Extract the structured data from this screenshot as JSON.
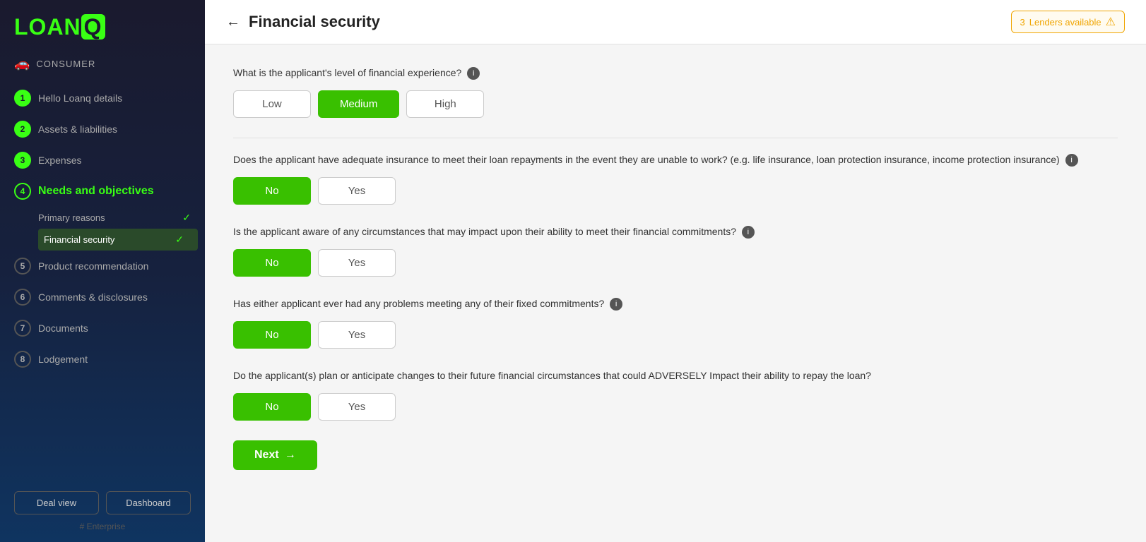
{
  "app": {
    "logo_text": "LOANQ",
    "logo_q": "Q"
  },
  "sidebar": {
    "consumer_label": "CONSUMER",
    "nav_items": [
      {
        "id": 1,
        "label": "Hello Loanq details",
        "state": "done"
      },
      {
        "id": 2,
        "label": "Assets & liabilities",
        "state": "done"
      },
      {
        "id": 3,
        "label": "Expenses",
        "state": "done"
      },
      {
        "id": 4,
        "label": "Needs and objectives",
        "state": "active"
      },
      {
        "id": 5,
        "label": "Product recommendation",
        "state": "default"
      },
      {
        "id": 6,
        "label": "Comments & disclosures",
        "state": "default"
      },
      {
        "id": 7,
        "label": "Documents",
        "state": "default"
      },
      {
        "id": 8,
        "label": "Lodgement",
        "state": "default"
      }
    ],
    "sub_nav": {
      "primary_reasons_label": "Primary reasons",
      "financial_security_label": "Financial security"
    },
    "deal_view_btn": "Deal view",
    "dashboard_btn": "Dashboard",
    "enterprise_label": "# Enterprise"
  },
  "header": {
    "back_label": "←",
    "page_title": "Financial security",
    "lenders_badge": "3  Lenders available",
    "lenders_count": "3"
  },
  "form": {
    "q1": {
      "text": "What is the applicant's level of financial experience?",
      "options": [
        "Low",
        "Medium",
        "High"
      ],
      "selected": "Medium"
    },
    "q2": {
      "text": "Does the applicant have adequate insurance to meet their loan repayments in the event they are unable to work? (e.g. life insurance, loan protection insurance, income protection insurance)",
      "options": [
        "No",
        "Yes"
      ],
      "selected": "No"
    },
    "q3": {
      "text": "Is the applicant aware of any circumstances that may impact upon their ability to meet their financial commitments?",
      "options": [
        "No",
        "Yes"
      ],
      "selected": "No"
    },
    "q4": {
      "text": "Has either applicant ever had any problems meeting any of their fixed commitments?",
      "options": [
        "No",
        "Yes"
      ],
      "selected": "No"
    },
    "q5": {
      "text": "Do the applicant(s) plan or anticipate changes to their future financial circumstances that could ADVERSELY Impact their ability to repay the loan?",
      "options": [
        "No",
        "Yes"
      ],
      "selected": "No"
    },
    "next_btn": "Next"
  }
}
